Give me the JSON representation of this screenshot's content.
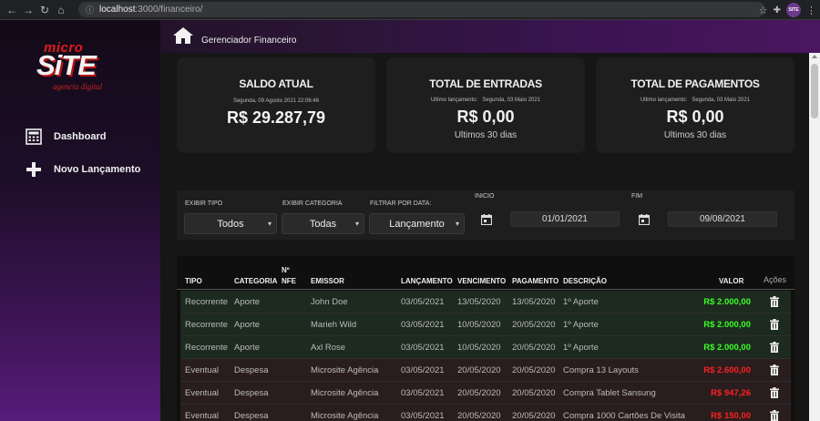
{
  "browser": {
    "url_host": "localhost",
    "url_rest": ":3000/financeiro/",
    "profile_badge": "SITE"
  },
  "sidebar": {
    "logo": {
      "micro": "micro",
      "site": "SiTE",
      "agency": "agencia digital"
    },
    "items": [
      {
        "label": "Dashboard",
        "icon": "calculator-icon"
      },
      {
        "label": "Novo Lançamento",
        "icon": "plus-icon"
      }
    ]
  },
  "header": {
    "title": "Gerenciador Financeiro"
  },
  "cards": {
    "saldo": {
      "title": "SALDO ATUAL",
      "date": "Segunda, 09 Agosto 2021  22:06:46",
      "value": "R$ 29.287,79"
    },
    "entradas": {
      "title": "TOTAL DE ENTRADAS",
      "last_label": "Ultimo lançamento:",
      "last_date": "Segunda, 03 Maio 2021",
      "value": "R$ 0,00",
      "note": "Ultimos 30 dias"
    },
    "pagamentos": {
      "title": "TOTAL DE PAGAMENTOS",
      "last_label": "Ultimo lançamento:",
      "last_date": "Segunda, 03 Maio 2021",
      "value": "R$ 0,00",
      "note": "Ultimos 30 dias"
    }
  },
  "filters": {
    "tipo": {
      "label": "EXIBIR TIPO",
      "value": "Todos"
    },
    "categoria": {
      "label": "EXIBIR CATEGORIA",
      "value": "Todas"
    },
    "data": {
      "label": "FILTRAR POR DATA:",
      "value": "Lançamento"
    },
    "inicio": {
      "label": "INICIO",
      "value": "01/01/2021"
    },
    "fim": {
      "label": "FIM",
      "value": "09/08/2021"
    }
  },
  "table": {
    "headers": {
      "tipo": "TIPO",
      "categoria": "CATEGORIA",
      "nfe1": "Nº",
      "nfe2": "NFE",
      "emissor": "EMISSOR",
      "lancamento": "LANÇAMENTO",
      "vencimento": "VENCIMENTO",
      "pagamento": "PAGAMENTO",
      "descricao": "DESCRIÇÃO",
      "valor": "VALOR",
      "acoes": "Ações"
    },
    "rows": [
      {
        "tipo": "Recorrente",
        "categoria": "Aporte",
        "nfe": "",
        "emissor": "John Doe",
        "lancamento": "03/05/2021",
        "vencimento": "13/05/2020",
        "pagamento": "13/05/2020",
        "descricao": "1º Aporte",
        "valor": "R$ 2.000,00",
        "kind": "in"
      },
      {
        "tipo": "Recorrente",
        "categoria": "Aporte",
        "nfe": "",
        "emissor": "Marieh Wild",
        "lancamento": "03/05/2021",
        "vencimento": "10/05/2020",
        "pagamento": "20/05/2020",
        "descricao": "1º Aporte",
        "valor": "R$ 2.000,00",
        "kind": "in"
      },
      {
        "tipo": "Recorrente",
        "categoria": "Aporte",
        "nfe": "",
        "emissor": "Axl Rose",
        "lancamento": "03/05/2021",
        "vencimento": "10/05/2020",
        "pagamento": "20/05/2020",
        "descricao": "1º Aporte",
        "valor": "R$ 2.000,00",
        "kind": "in"
      },
      {
        "tipo": "Eventual",
        "categoria": "Despesa",
        "nfe": "",
        "emissor": "Microsite Agência",
        "lancamento": "03/05/2021",
        "vencimento": "20/05/2020",
        "pagamento": "20/05/2020",
        "descricao": "Compra 13 Layouts",
        "valor": "R$ 2.600,00",
        "kind": "out"
      },
      {
        "tipo": "Eventual",
        "categoria": "Despesa",
        "nfe": "",
        "emissor": "Microsite Agência",
        "lancamento": "03/05/2021",
        "vencimento": "20/05/2020",
        "pagamento": "20/05/2020",
        "descricao": "Compra Tablet Sansung",
        "valor": "R$ 947,26",
        "kind": "out"
      },
      {
        "tipo": "Eventual",
        "categoria": "Despesa",
        "nfe": "",
        "emissor": "Microsite Agência",
        "lancamento": "03/05/2021",
        "vencimento": "20/05/2020",
        "pagamento": "20/05/2020",
        "descricao": "Compra 1000 Cartões De Visita",
        "valor": "R$ 150,00",
        "kind": "out"
      }
    ]
  },
  "colors": {
    "income_row": "#1d2a1f",
    "expense_row": "#2a1d1d",
    "income_value": "#3cff2a",
    "expense_value": "#ff2020",
    "brand_red": "#e01b1b",
    "sidebar_purple": "#571c7a"
  }
}
